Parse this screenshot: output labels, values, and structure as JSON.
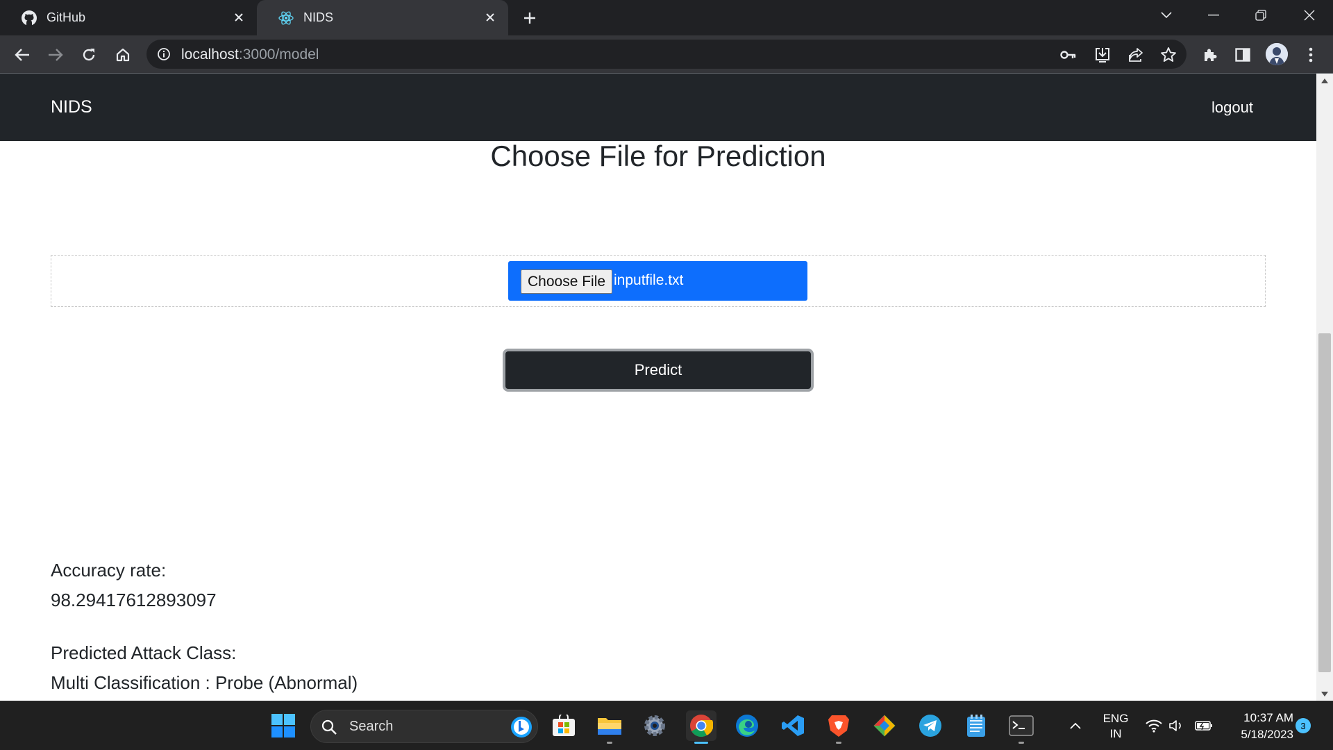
{
  "browser": {
    "tabs": [
      {
        "title": "GitHub",
        "icon": "github-icon",
        "active": false
      },
      {
        "title": "NIDS",
        "icon": "react-icon",
        "active": true
      }
    ],
    "url_host": "localhost",
    "url_path": ":3000/model"
  },
  "navbar": {
    "brand": "NIDS",
    "logout_label": "logout"
  },
  "page": {
    "heading": "Choose File for Prediction",
    "file_button_label": "Choose File",
    "file_name": "inputfile.txt",
    "predict_label": "Predict",
    "accuracy_label": "Accuracy rate:",
    "accuracy_value": "98.29417612893097",
    "attack_label": "Predicted Attack Class:",
    "attack_value": "Multi Classification : Probe (Abnormal)"
  },
  "taskbar": {
    "search_placeholder": "Search",
    "language_line1": "ENG",
    "language_line2": "IN",
    "time": "10:37 AM",
    "date": "5/18/2023",
    "notification_count": "3"
  },
  "colors": {
    "navbar_bg": "#212529",
    "file_input_bg": "#0d6efd",
    "predict_bg": "#212529"
  }
}
